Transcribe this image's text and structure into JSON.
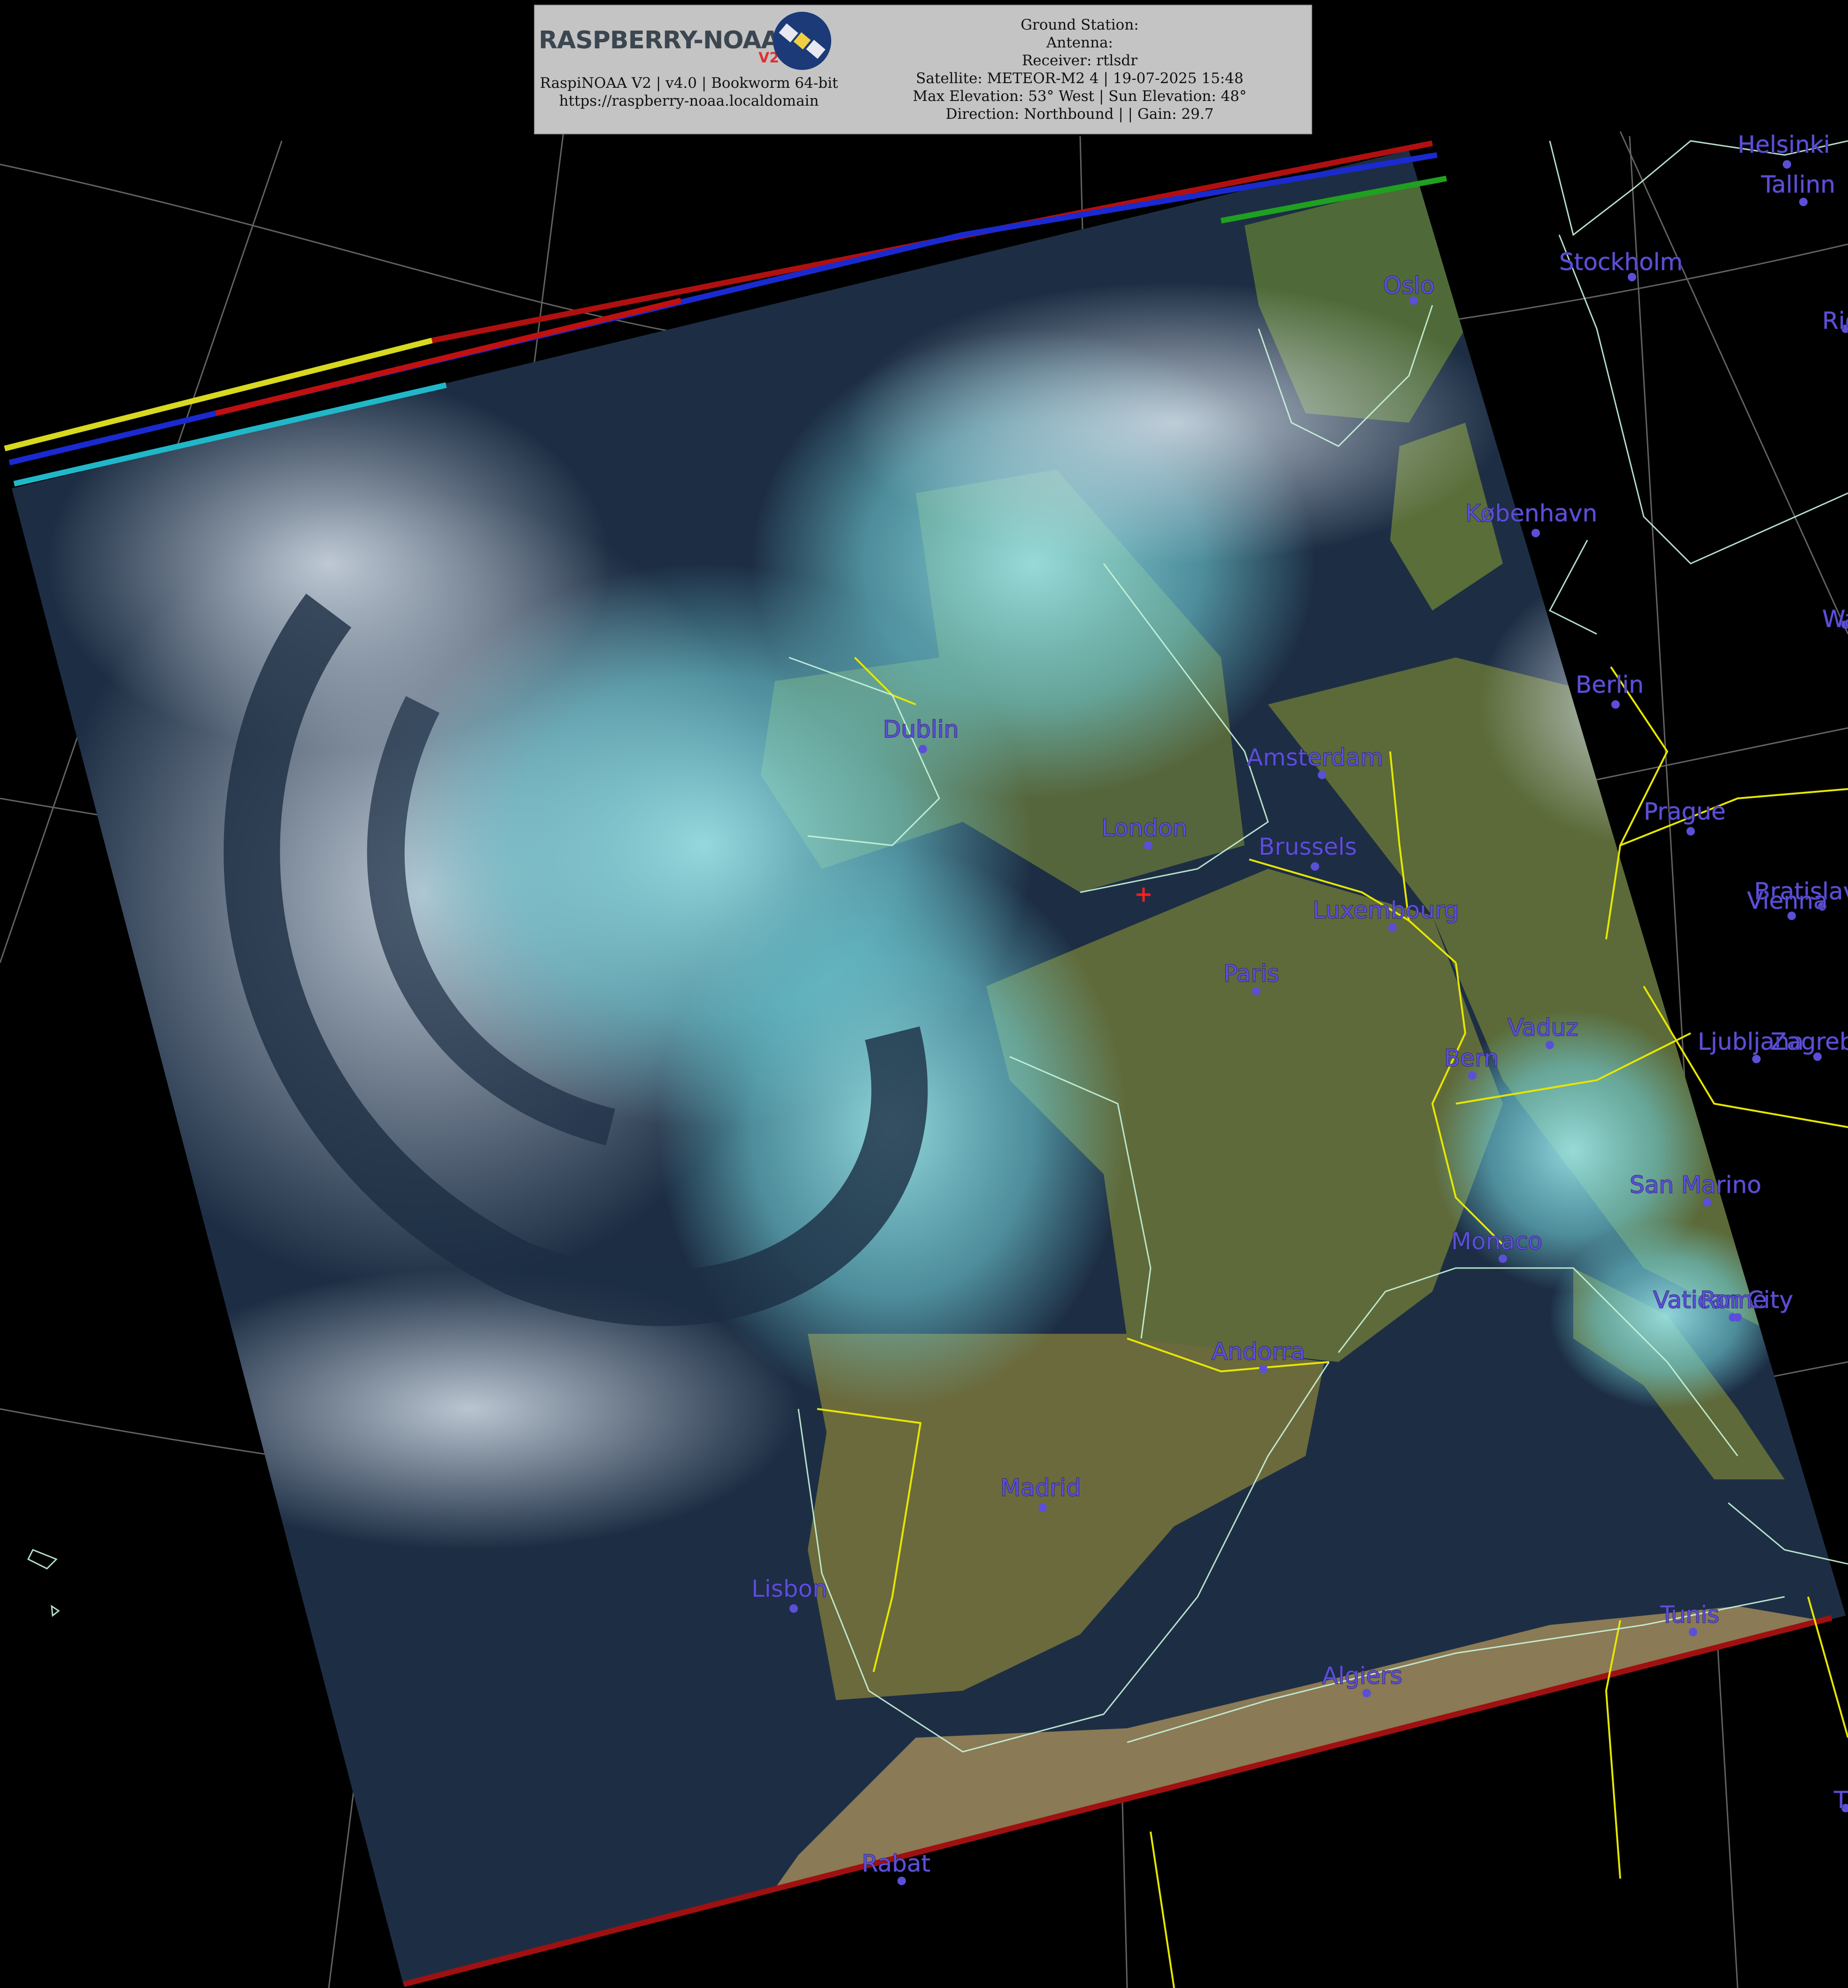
{
  "header": {
    "logo_text": "RASPBERRY-NOAA",
    "logo_version_badge": "V2",
    "software_line": "RaspiNOAA V2 | v4.0 | Bookworm 64-bit",
    "url": "https://raspberry-noaa.localdomain",
    "ground_station": "Ground Station:",
    "antenna": "Antenna:",
    "receiver": "Receiver: rtlsdr",
    "satellite": "Satellite: METEOR-M2 4 | 19-07-2025 15:48",
    "elevation": "Max Elevation: 53° West | Sun Elevation: 48°",
    "direction": "Direction: Northbound | | Gain: 29.7"
  },
  "cities": [
    {
      "name": "Oslo"
    },
    {
      "name": "Stockholm"
    },
    {
      "name": "Helsinki"
    },
    {
      "name": "Tallinn"
    },
    {
      "name": "Riga"
    },
    {
      "name": "København"
    },
    {
      "name": "Berlin"
    },
    {
      "name": "Warsaw"
    },
    {
      "name": "Dublin"
    },
    {
      "name": "Amsterdam"
    },
    {
      "name": "London"
    },
    {
      "name": "Brussels"
    },
    {
      "name": "Prague"
    },
    {
      "name": "Luxembourg"
    },
    {
      "name": "Bratislava"
    },
    {
      "name": "Vienna"
    },
    {
      "name": "Paris"
    },
    {
      "name": "Vaduz"
    },
    {
      "name": "Bern"
    },
    {
      "name": "Ljubljana"
    },
    {
      "name": "Zagreb"
    },
    {
      "name": "San Marino"
    },
    {
      "name": "Monaco"
    },
    {
      "name": "Vatican City"
    },
    {
      "name": "Rome"
    },
    {
      "name": "Andorra"
    },
    {
      "name": "Madrid"
    },
    {
      "name": "Lisbon"
    },
    {
      "name": "Tunis"
    },
    {
      "name": "Algiers"
    },
    {
      "name": "Rabat"
    },
    {
      "name": "Tirana"
    }
  ],
  "colors": {
    "city_label": "#5b4fd8",
    "border": "#e6e600",
    "coastline": "#c8f5dc",
    "grid": "#9a9a9a",
    "ocean": "#1d2e44",
    "cloud": "#8ee6ea",
    "land": "#5e6a38",
    "station_marker": "#ff2020"
  },
  "icons": {
    "station_marker": "red-cross-icon",
    "logo": "satellite-icon"
  }
}
